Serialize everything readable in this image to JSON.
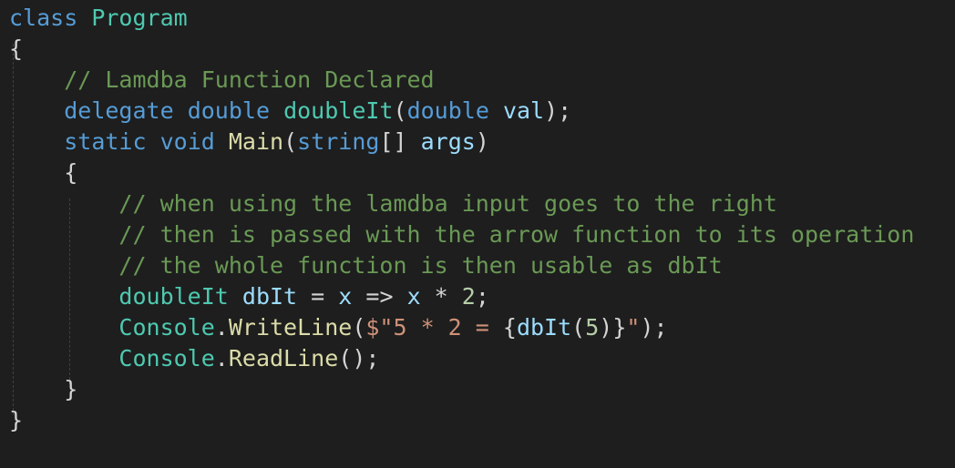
{
  "editor": {
    "theme": {
      "background": "#1e1e1e",
      "keyword": "#569cd6",
      "type": "#4ec9b0",
      "method": "#dcdcaa",
      "parameter": "#9cdcfe",
      "string": "#ce9178",
      "number": "#b5cea8",
      "comment": "#6a9955",
      "punctuation": "#d4d4d4"
    },
    "lines": [
      {
        "tokens": [
          {
            "t": "class",
            "k": "keyword"
          },
          {
            "t": " "
          },
          {
            "t": "Program",
            "k": "type"
          }
        ]
      },
      {
        "tokens": [
          {
            "t": "{"
          }
        ]
      },
      {
        "tokens": [
          {
            "t": "    "
          },
          {
            "t": "// Lamdba Function Declared",
            "k": "comment"
          }
        ]
      },
      {
        "tokens": [
          {
            "t": "    "
          },
          {
            "t": "delegate",
            "k": "keyword"
          },
          {
            "t": " "
          },
          {
            "t": "double",
            "k": "keyword"
          },
          {
            "t": " "
          },
          {
            "t": "doubleIt",
            "k": "type"
          },
          {
            "t": "("
          },
          {
            "t": "double",
            "k": "keyword"
          },
          {
            "t": " "
          },
          {
            "t": "val",
            "k": "param"
          },
          {
            "t": ");"
          }
        ]
      },
      {
        "tokens": [
          {
            "t": "    "
          },
          {
            "t": "static",
            "k": "keyword"
          },
          {
            "t": " "
          },
          {
            "t": "void",
            "k": "keyword"
          },
          {
            "t": " "
          },
          {
            "t": "Main",
            "k": "method"
          },
          {
            "t": "("
          },
          {
            "t": "string",
            "k": "keyword"
          },
          {
            "t": "[] "
          },
          {
            "t": "args",
            "k": "param"
          },
          {
            "t": ")"
          }
        ]
      },
      {
        "tokens": [
          {
            "t": "    {"
          }
        ]
      },
      {
        "tokens": [
          {
            "t": "        "
          },
          {
            "t": "// when using the lamdba input goes to the right",
            "k": "comment"
          }
        ]
      },
      {
        "tokens": [
          {
            "t": "        "
          },
          {
            "t": "// then is passed with the arrow function to its operation",
            "k": "comment"
          }
        ]
      },
      {
        "tokens": [
          {
            "t": "        "
          },
          {
            "t": "// the whole function is then usable as dbIt",
            "k": "comment"
          }
        ]
      },
      {
        "tokens": [
          {
            "t": "        "
          },
          {
            "t": "doubleIt",
            "k": "type"
          },
          {
            "t": " "
          },
          {
            "t": "dbIt",
            "k": "param"
          },
          {
            "t": " = "
          },
          {
            "t": "x",
            "k": "param"
          },
          {
            "t": " => "
          },
          {
            "t": "x",
            "k": "param"
          },
          {
            "t": " * "
          },
          {
            "t": "2",
            "k": "number"
          },
          {
            "t": ";"
          }
        ]
      },
      {
        "tokens": [
          {
            "t": "        "
          },
          {
            "t": "Console",
            "k": "type"
          },
          {
            "t": "."
          },
          {
            "t": "WriteLine",
            "k": "method"
          },
          {
            "t": "("
          },
          {
            "t": "$\"5 * 2 = ",
            "k": "string"
          },
          {
            "t": "{"
          },
          {
            "t": "dbIt",
            "k": "param"
          },
          {
            "t": "("
          },
          {
            "t": "5",
            "k": "number"
          },
          {
            "t": ")}"
          },
          {
            "t": "\"",
            "k": "string"
          },
          {
            "t": ");"
          }
        ]
      },
      {
        "tokens": [
          {
            "t": "        "
          },
          {
            "t": "Console",
            "k": "type"
          },
          {
            "t": "."
          },
          {
            "t": "ReadLine",
            "k": "method"
          },
          {
            "t": "();"
          }
        ]
      },
      {
        "tokens": [
          {
            "t": "    }"
          }
        ]
      },
      {
        "tokens": [
          {
            "t": "}"
          }
        ]
      }
    ]
  }
}
